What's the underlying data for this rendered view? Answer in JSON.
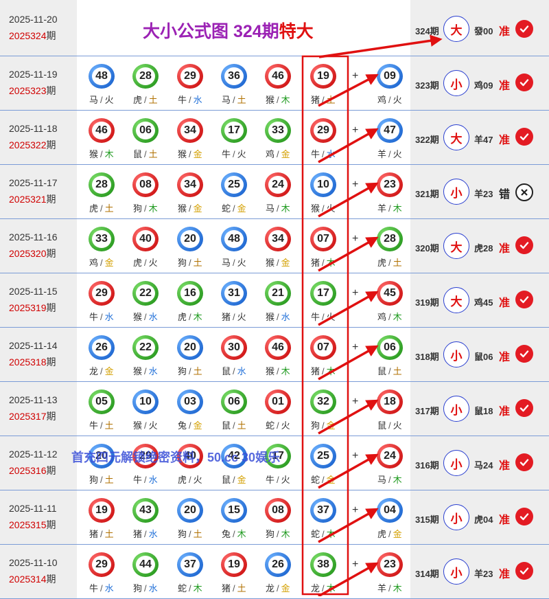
{
  "title": {
    "main": "大小公式图 324期",
    "accent": "特大"
  },
  "header": {
    "date": "2025-11-20",
    "issue_num": "2025324",
    "issue_suffix": "期",
    "period": "324期",
    "size": "大",
    "zodiac_num": "發00",
    "result": "准"
  },
  "rows": [
    {
      "date": "2025-11-19",
      "issue_num": "2025323",
      "issue_suffix": "期",
      "balls": [
        {
          "num": "48",
          "color": "blue",
          "zodiac": "马",
          "element": "火"
        },
        {
          "num": "28",
          "color": "green",
          "zodiac": "虎",
          "element": "土"
        },
        {
          "num": "29",
          "color": "red",
          "zodiac": "牛",
          "element": "水"
        },
        {
          "num": "36",
          "color": "blue",
          "zodiac": "马",
          "element": "土"
        },
        {
          "num": "46",
          "color": "red",
          "zodiac": "猴",
          "element": "木"
        },
        {
          "num": "19",
          "color": "red",
          "zodiac": "猪",
          "element": "土"
        }
      ],
      "special": {
        "num": "09",
        "color": "blue",
        "zodiac": "鸡",
        "element": "火"
      },
      "period": "323期",
      "size": "小",
      "zodiac_num": "鸡09",
      "result": "准"
    },
    {
      "date": "2025-11-18",
      "issue_num": "2025322",
      "issue_suffix": "期",
      "balls": [
        {
          "num": "46",
          "color": "red",
          "zodiac": "猴",
          "element": "木"
        },
        {
          "num": "06",
          "color": "green",
          "zodiac": "鼠",
          "element": "土"
        },
        {
          "num": "34",
          "color": "red",
          "zodiac": "猴",
          "element": "金"
        },
        {
          "num": "17",
          "color": "green",
          "zodiac": "牛",
          "element": "火"
        },
        {
          "num": "33",
          "color": "green",
          "zodiac": "鸡",
          "element": "金"
        },
        {
          "num": "29",
          "color": "red",
          "zodiac": "牛",
          "element": "水"
        }
      ],
      "special": {
        "num": "47",
        "color": "blue",
        "zodiac": "羊",
        "element": "火"
      },
      "period": "322期",
      "size": "大",
      "zodiac_num": "羊47",
      "result": "准"
    },
    {
      "date": "2025-11-17",
      "issue_num": "2025321",
      "issue_suffix": "期",
      "balls": [
        {
          "num": "28",
          "color": "green",
          "zodiac": "虎",
          "element": "土"
        },
        {
          "num": "08",
          "color": "red",
          "zodiac": "狗",
          "element": "木"
        },
        {
          "num": "34",
          "color": "red",
          "zodiac": "猴",
          "element": "金"
        },
        {
          "num": "25",
          "color": "blue",
          "zodiac": "蛇",
          "element": "金"
        },
        {
          "num": "24",
          "color": "red",
          "zodiac": "马",
          "element": "木"
        },
        {
          "num": "10",
          "color": "blue",
          "zodiac": "猴",
          "element": "火"
        }
      ],
      "special": {
        "num": "23",
        "color": "red",
        "zodiac": "羊",
        "element": "木"
      },
      "period": "321期",
      "size": "小",
      "zodiac_num": "羊23",
      "result": "错"
    },
    {
      "date": "2025-11-16",
      "issue_num": "2025320",
      "issue_suffix": "期",
      "balls": [
        {
          "num": "33",
          "color": "green",
          "zodiac": "鸡",
          "element": "金"
        },
        {
          "num": "40",
          "color": "red",
          "zodiac": "虎",
          "element": "火"
        },
        {
          "num": "20",
          "color": "blue",
          "zodiac": "狗",
          "element": "土"
        },
        {
          "num": "48",
          "color": "blue",
          "zodiac": "马",
          "element": "火"
        },
        {
          "num": "34",
          "color": "red",
          "zodiac": "猴",
          "element": "金"
        },
        {
          "num": "07",
          "color": "red",
          "zodiac": "猪",
          "element": "木"
        }
      ],
      "special": {
        "num": "28",
        "color": "green",
        "zodiac": "虎",
        "element": "土"
      },
      "period": "320期",
      "size": "大",
      "zodiac_num": "虎28",
      "result": "准"
    },
    {
      "date": "2025-11-15",
      "issue_num": "2025319",
      "issue_suffix": "期",
      "balls": [
        {
          "num": "29",
          "color": "red",
          "zodiac": "牛",
          "element": "水"
        },
        {
          "num": "22",
          "color": "green",
          "zodiac": "猴",
          "element": "水"
        },
        {
          "num": "16",
          "color": "green",
          "zodiac": "虎",
          "element": "木"
        },
        {
          "num": "31",
          "color": "blue",
          "zodiac": "猪",
          "element": "火"
        },
        {
          "num": "21",
          "color": "green",
          "zodiac": "猴",
          "element": "水"
        },
        {
          "num": "17",
          "color": "green",
          "zodiac": "牛",
          "element": "火"
        }
      ],
      "special": {
        "num": "45",
        "color": "red",
        "zodiac": "鸡",
        "element": "木"
      },
      "period": "319期",
      "size": "大",
      "zodiac_num": "鸡45",
      "result": "准"
    },
    {
      "date": "2025-11-14",
      "issue_num": "2025318",
      "issue_suffix": "期",
      "balls": [
        {
          "num": "26",
          "color": "blue",
          "zodiac": "龙",
          "element": "金"
        },
        {
          "num": "22",
          "color": "green",
          "zodiac": "猴",
          "element": "水"
        },
        {
          "num": "20",
          "color": "blue",
          "zodiac": "狗",
          "element": "土"
        },
        {
          "num": "30",
          "color": "red",
          "zodiac": "鼠",
          "element": "水"
        },
        {
          "num": "46",
          "color": "red",
          "zodiac": "猴",
          "element": "木"
        },
        {
          "num": "07",
          "color": "red",
          "zodiac": "猪",
          "element": "木"
        }
      ],
      "special": {
        "num": "06",
        "color": "green",
        "zodiac": "鼠",
        "element": "土"
      },
      "period": "318期",
      "size": "小",
      "zodiac_num": "鼠06",
      "result": "准"
    },
    {
      "date": "2025-11-13",
      "issue_num": "2025317",
      "issue_suffix": "期",
      "balls": [
        {
          "num": "05",
          "color": "green",
          "zodiac": "牛",
          "element": "土"
        },
        {
          "num": "10",
          "color": "blue",
          "zodiac": "猴",
          "element": "火"
        },
        {
          "num": "03",
          "color": "blue",
          "zodiac": "兔",
          "element": "金"
        },
        {
          "num": "06",
          "color": "green",
          "zodiac": "鼠",
          "element": "土"
        },
        {
          "num": "01",
          "color": "red",
          "zodiac": "蛇",
          "element": "火"
        },
        {
          "num": "32",
          "color": "green",
          "zodiac": "狗",
          "element": "金"
        }
      ],
      "special": {
        "num": "18",
        "color": "red",
        "zodiac": "鼠",
        "element": "火"
      },
      "period": "317期",
      "size": "小",
      "zodiac_num": "鼠18",
      "result": "准"
    },
    {
      "date": "2025-11-12",
      "issue_num": "2025316",
      "issue_suffix": "期",
      "balls": [
        {
          "num": "20",
          "color": "blue",
          "zodiac": "狗",
          "element": "土"
        },
        {
          "num": "29",
          "color": "red",
          "zodiac": "牛",
          "element": "水"
        },
        {
          "num": "40",
          "color": "red",
          "zodiac": "虎",
          "element": "火"
        },
        {
          "num": "42",
          "color": "blue",
          "zodiac": "鼠",
          "element": "金"
        },
        {
          "num": "17",
          "color": "green",
          "zodiac": "牛",
          "element": "火"
        },
        {
          "num": "25",
          "color": "blue",
          "zodiac": "蛇",
          "element": "金"
        }
      ],
      "special": {
        "num": "24",
        "color": "red",
        "zodiac": "马",
        "element": "木"
      },
      "period": "316期",
      "size": "小",
      "zodiac_num": "马24",
      "result": "准"
    },
    {
      "date": "2025-11-11",
      "issue_num": "2025315",
      "issue_suffix": "期",
      "balls": [
        {
          "num": "19",
          "color": "red",
          "zodiac": "猪",
          "element": "土"
        },
        {
          "num": "43",
          "color": "green",
          "zodiac": "猪",
          "element": "水"
        },
        {
          "num": "20",
          "color": "blue",
          "zodiac": "狗",
          "element": "土"
        },
        {
          "num": "15",
          "color": "blue",
          "zodiac": "兔",
          "element": "木"
        },
        {
          "num": "08",
          "color": "red",
          "zodiac": "狗",
          "element": "木"
        },
        {
          "num": "37",
          "color": "blue",
          "zodiac": "蛇",
          "element": "木"
        }
      ],
      "special": {
        "num": "04",
        "color": "blue",
        "zodiac": "虎",
        "element": "金"
      },
      "period": "315期",
      "size": "小",
      "zodiac_num": "虎04",
      "result": "准"
    },
    {
      "date": "2025-11-10",
      "issue_num": "2025314",
      "issue_suffix": "期",
      "balls": [
        {
          "num": "29",
          "color": "red",
          "zodiac": "牛",
          "element": "水"
        },
        {
          "num": "44",
          "color": "green",
          "zodiac": "狗",
          "element": "水"
        },
        {
          "num": "37",
          "color": "blue",
          "zodiac": "蛇",
          "element": "木"
        },
        {
          "num": "19",
          "color": "red",
          "zodiac": "猪",
          "element": "土"
        },
        {
          "num": "26",
          "color": "blue",
          "zodiac": "龙",
          "element": "金"
        },
        {
          "num": "38",
          "color": "green",
          "zodiac": "龙",
          "element": "木"
        }
      ],
      "special": {
        "num": "23",
        "color": "red",
        "zodiac": "羊",
        "element": "木"
      },
      "period": "314期",
      "size": "小",
      "zodiac_num": "羊23",
      "result": "准"
    }
  ],
  "plus_sign": "+",
  "label_separator": "/",
  "watermark": "首充四元解锁绝密资料，50.cc 30娱乐",
  "colors": {
    "accent_red": "#e01010",
    "title_purple": "#9b22b4",
    "grid_blue": "#7a9bd6",
    "highlight_box": "#e01010",
    "check_red": "#e31b23"
  }
}
